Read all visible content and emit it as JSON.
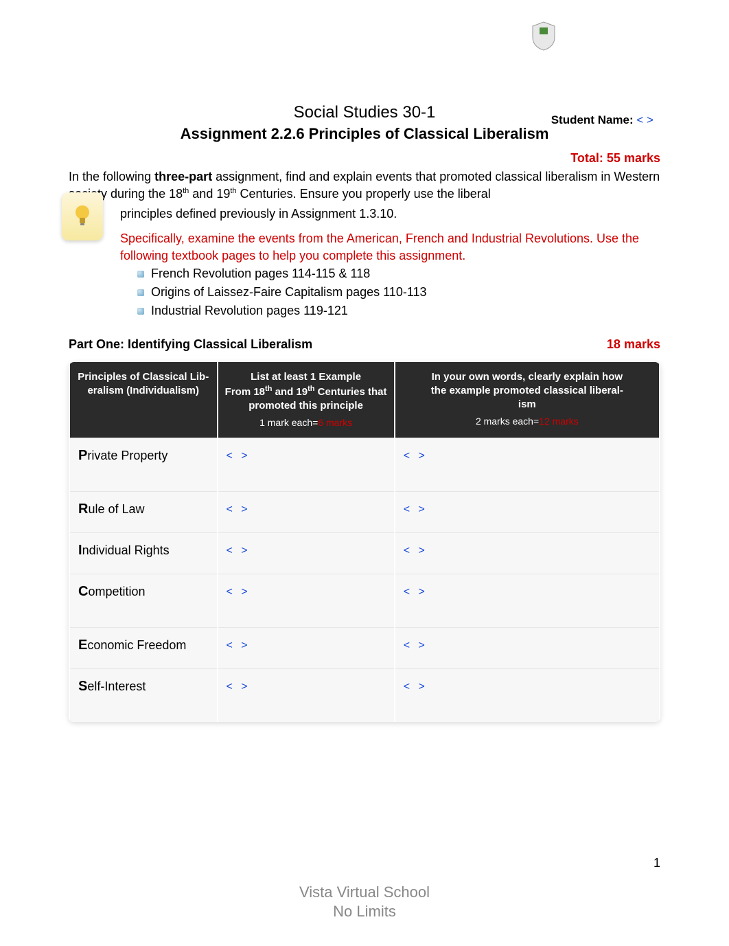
{
  "header": {
    "course": "Social Studies 30-1",
    "assignment_title": "Assignment 2.2.6 Principles of Classical Liberalism",
    "student_name_label": "Student Name:",
    "student_name_value": "< >",
    "total_label": "Total:",
    "total_value": "55 marks"
  },
  "intro": {
    "line1_pre": "In the following ",
    "line1_bold": "three-part",
    "line1_post": " assignment, find and explain events that promoted classical liberalism in Western society during the 18",
    "line1_th1": "th",
    "line1_mid": " and 19",
    "line1_th2": "th",
    "line1_end": " Centuries. Ensure you properly use the liberal",
    "line2": "principles defined previously in Assignment 1.3.10.",
    "specific": "Specifically, examine the events from the American, French and Industrial Revolutions. Use the following textbook pages to help you complete this assignment.",
    "refs": [
      "French Revolution pages 114-115 & 118",
      "Origins of Laissez-Faire Capitalism pages 110-113",
      "Industrial Revolution pages 119-121"
    ]
  },
  "part_one": {
    "title": "Part One: Identifying Classical Liberalism",
    "marks": "18 marks",
    "table": {
      "col1_l1": "Principles of Classical Lib-",
      "col1_l2": "eralism (Individualism)",
      "col2_l1": "List at least 1 Example",
      "col2_l2_pre": "From 18",
      "col2_l2_mid": " and 19",
      "col2_l2_end": " Centuries that",
      "col2_l3": "promoted this principle",
      "col2_sub_pre": "1 mark each=",
      "col2_sub_red": "6 marks",
      "col3_l1": "In your own words, clearly explain how",
      "col3_l2": "the example promoted classical liberal-",
      "col3_l3": "ism",
      "col3_sub_pre": "2 marks each=",
      "col3_sub_red": "12 marks"
    },
    "rows": [
      {
        "letter": "P",
        "rest": "rivate Property",
        "example": "<  >",
        "explain": "<  >"
      },
      {
        "letter": "R",
        "rest": "ule of Law",
        "example": "<  >",
        "explain": "<  >"
      },
      {
        "letter": "I",
        "rest": "ndividual Rights",
        "example": "<  >",
        "explain": "<  >"
      },
      {
        "letter": "C",
        "rest": "ompetition",
        "example": "<  >",
        "explain": "<  >"
      },
      {
        "letter": "E",
        "rest": "conomic Freedom",
        "example": "<  >",
        "explain": "<  >"
      },
      {
        "letter": "S",
        "rest": "elf-Interest",
        "example": "<  >",
        "explain": "<  >"
      }
    ]
  },
  "footer": {
    "line1": "Vista Virtual School",
    "line2": "No Limits",
    "page": "1"
  }
}
